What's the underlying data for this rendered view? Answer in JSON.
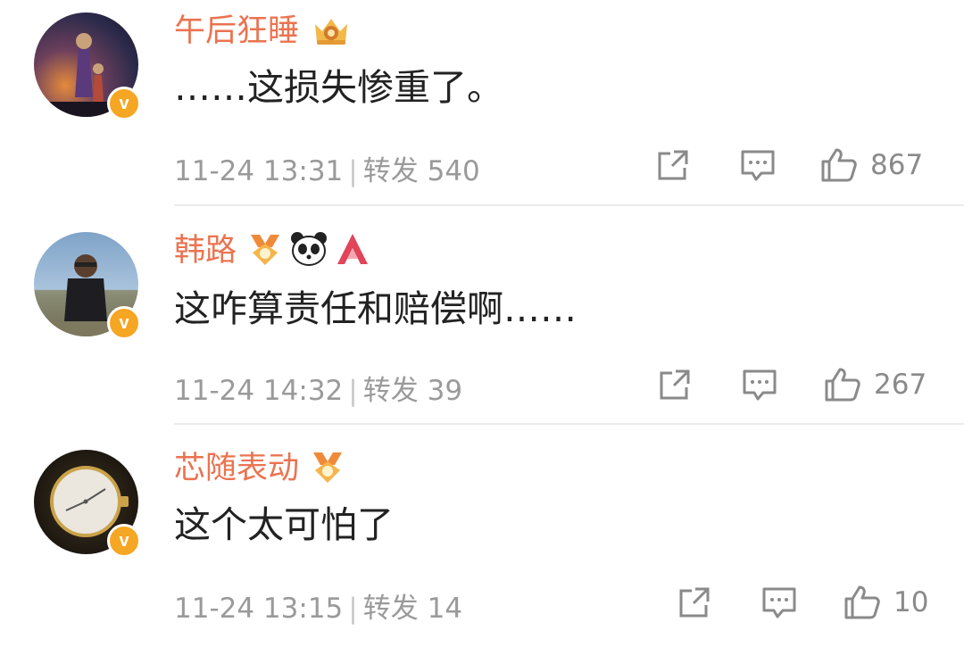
{
  "comments": [
    {
      "username": "午后狂睡",
      "text": "……这损失惨重了。",
      "date": "11-24 13:31",
      "repost_label": "转发",
      "repost_count": "540",
      "like_count": "867",
      "badges": [
        "crown-vip-icon"
      ]
    },
    {
      "username": "韩路",
      "text": "这咋算责任和赔偿啊……",
      "date": "11-24 14:32",
      "repost_label": "转发",
      "repost_count": "39",
      "like_count": "267",
      "badges": [
        "medal-icon",
        "panda-icon",
        "red-logo-icon"
      ]
    },
    {
      "username": "芯随表动",
      "text": "这个太可怕了",
      "date": "11-24 13:15",
      "repost_label": "转发",
      "repost_count": "14",
      "like_count": "10",
      "badges": [
        "medal-icon"
      ]
    }
  ],
  "colors": {
    "username": "#eb7350",
    "verified": "#f5a623",
    "meta": "#9a9a9a"
  }
}
